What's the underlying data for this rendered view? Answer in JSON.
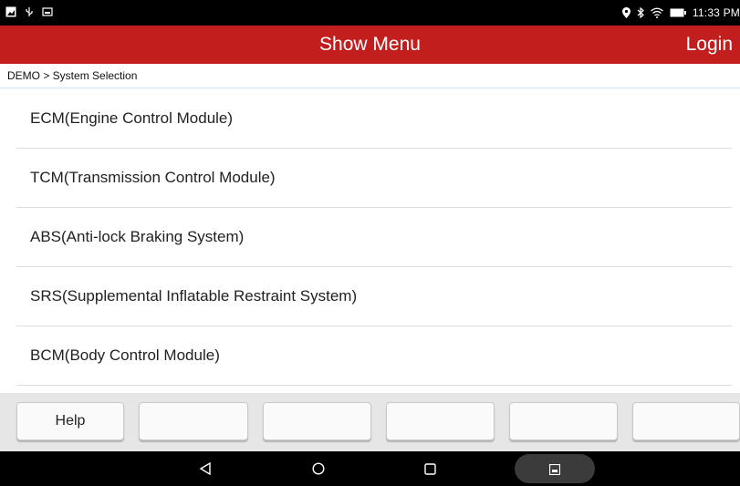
{
  "status_bar": {
    "time": "11:33 PM",
    "left_icons": [
      "image-notification-icon",
      "usb-icon",
      "gallery-icon"
    ],
    "right_icons": [
      "location-icon",
      "bluetooth-icon",
      "wifi-icon",
      "battery-icon"
    ]
  },
  "app_bar": {
    "title": "Show Menu",
    "login_label": "Login",
    "background_color": "#c31e1e"
  },
  "breadcrumb": {
    "text": "DEMO > System Selection"
  },
  "systems": [
    {
      "label": "ECM(Engine Control Module)"
    },
    {
      "label": "TCM(Transmission Control Module)"
    },
    {
      "label": "ABS(Anti-lock Braking System)"
    },
    {
      "label": "SRS(Supplemental Inflatable Restraint System)"
    },
    {
      "label": "BCM(Body Control Module)"
    }
  ],
  "toolbar": {
    "buttons": [
      {
        "label": "Help"
      },
      {
        "label": ""
      },
      {
        "label": ""
      },
      {
        "label": ""
      },
      {
        "label": ""
      },
      {
        "label": ""
      }
    ]
  },
  "nav_bar": {
    "icons": [
      "back-icon",
      "home-icon",
      "recents-icon",
      "screenshot-icon"
    ]
  }
}
